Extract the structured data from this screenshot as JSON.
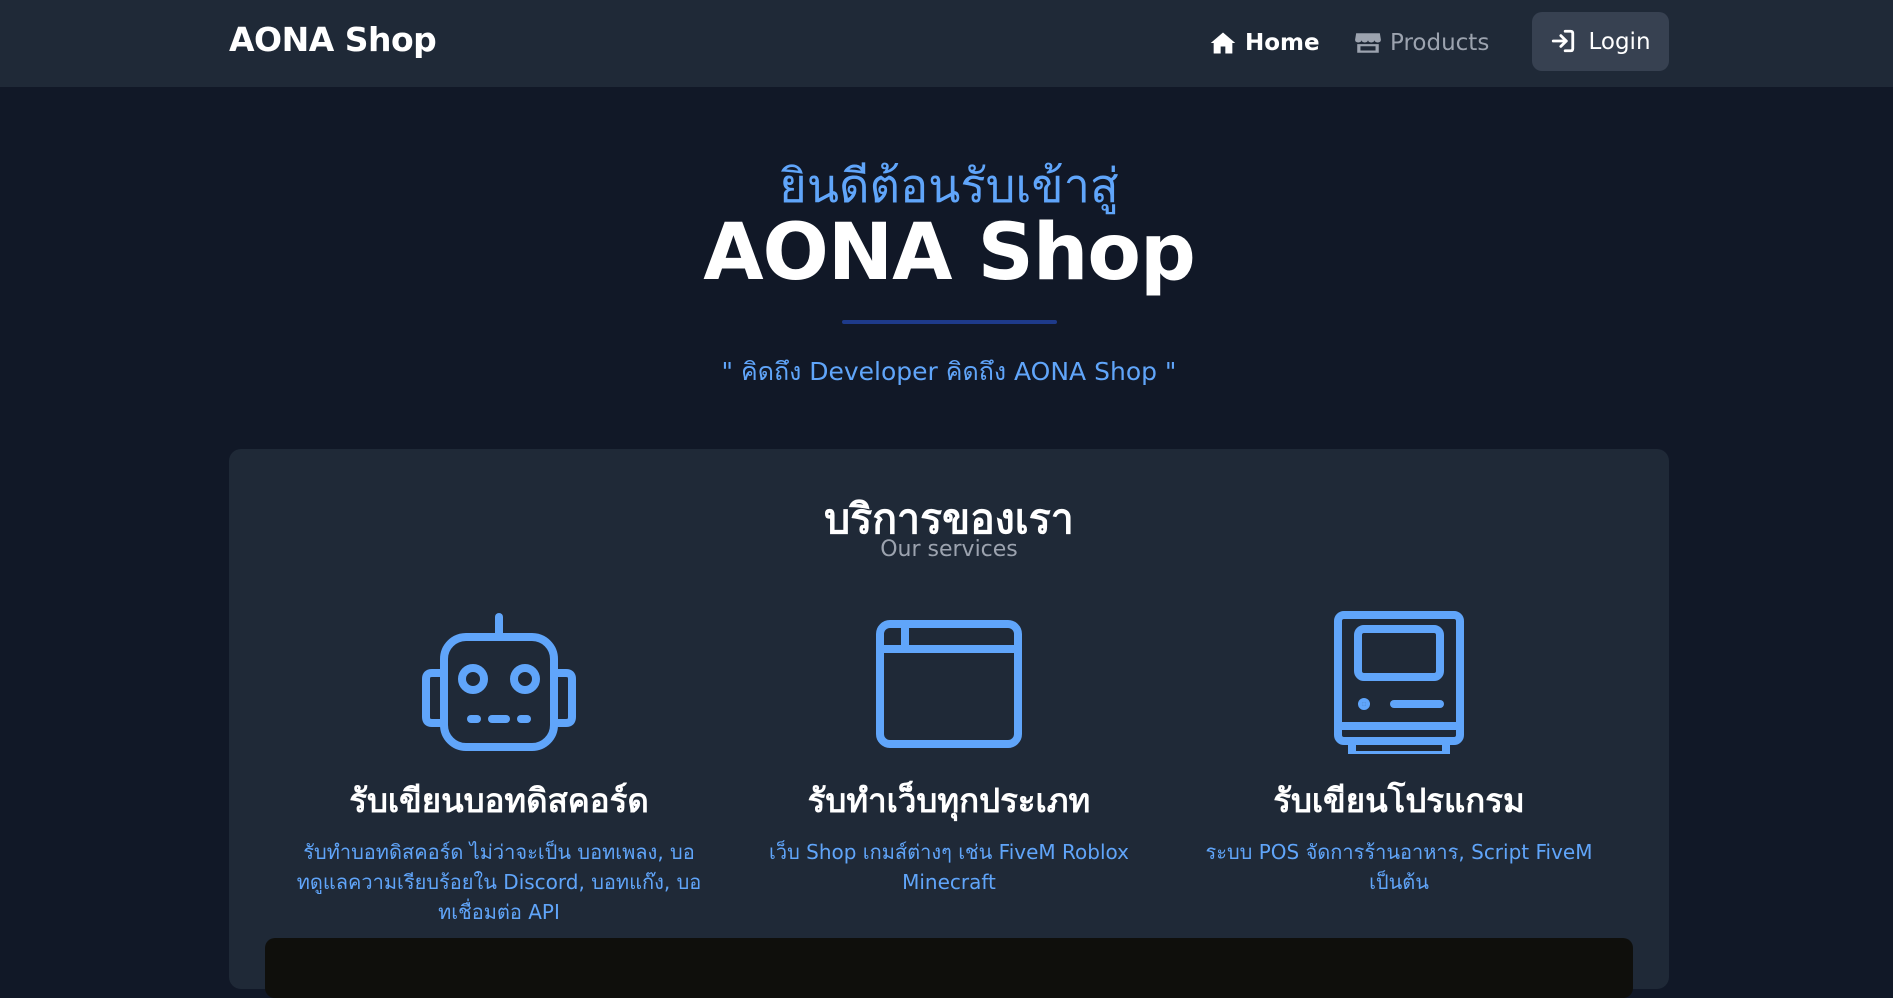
{
  "nav": {
    "brand": "AONA Shop",
    "home_label": "Home",
    "products_label": "Products",
    "login_label": "Login"
  },
  "hero": {
    "welcome": "ยินดีต้อนรับเข้าสู่",
    "title": "AONA Shop",
    "tagline": "\" คิดถึง Developer คิดถึง AONA Shop \""
  },
  "services": {
    "title": "บริการของเรา",
    "subtitle": "Our services",
    "items": [
      {
        "icon": "robot-icon",
        "title": "รับเขียนบอทดิสคอร์ด",
        "description": "รับทำบอทดิสคอร์ด ไม่ว่าจะเป็น บอทเพลง, บอทดูแลความเรียบร้อยใน Discord, บอทแก๊ง, บอทเชื่อมต่อ API"
      },
      {
        "icon": "browser-window-icon",
        "title": "รับทำเว็บทุกประเภท",
        "description": "เว็บ Shop เกมส์ต่างๆ เช่น FiveM Roblox Minecraft"
      },
      {
        "icon": "computer-icon",
        "title": "รับเขียนโปรแกรม",
        "description": "ระบบ POS จัดการร้านอาหาร, Script FiveM เป็นต้น"
      }
    ]
  },
  "colors": {
    "page_bg": "#111827",
    "nav_bg": "#1f2937",
    "card_bg": "#1f2937",
    "accent": "#60a5fa",
    "muted": "#9ca3af"
  }
}
